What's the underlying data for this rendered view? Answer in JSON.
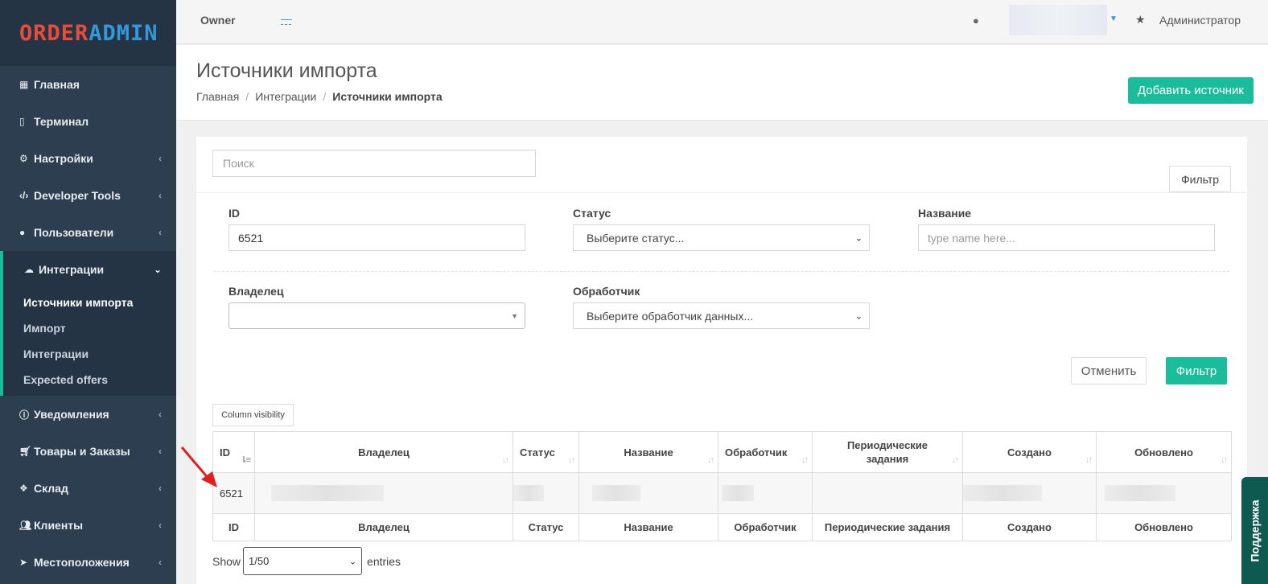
{
  "logo": {
    "part1": "ORDER",
    "part2": "ADMIN"
  },
  "sidebar": {
    "items": [
      {
        "label": "Главная",
        "icon": "grid-icon"
      },
      {
        "label": "Терминал",
        "icon": "terminal-icon"
      },
      {
        "label": "Настройки",
        "icon": "gear-icon",
        "has_children": true
      },
      {
        "label": "Developer Tools",
        "icon": "code-icon",
        "has_children": true
      },
      {
        "label": "Пользователи",
        "icon": "user-icon",
        "has_children": true
      },
      {
        "label": "Интеграции",
        "icon": "cloud-icon",
        "has_children": true,
        "expanded": true
      },
      {
        "label": "Уведомления",
        "icon": "info-icon",
        "has_children": true
      },
      {
        "label": "Товары и Заказы",
        "icon": "cart-icon",
        "has_children": true
      },
      {
        "label": "Склад",
        "icon": "cubes-icon",
        "has_children": true
      },
      {
        "label": "Клиенты",
        "icon": "users-icon",
        "has_children": true
      },
      {
        "label": "Местоположения",
        "icon": "location-arrow-icon",
        "has_children": true
      }
    ],
    "submenu": [
      {
        "label": "Источники импорта",
        "current": true
      },
      {
        "label": "Импорт"
      },
      {
        "label": "Интеграции"
      },
      {
        "label": "Expected offers"
      }
    ]
  },
  "topbar": {
    "owner_label": "Owner",
    "owner_value": "—",
    "admin_label": "Администратор"
  },
  "page": {
    "title": "Источники импорта",
    "breadcrumb": [
      "Главная",
      "Интеграции",
      "Источники импорта"
    ],
    "add_button": "Добавить источник"
  },
  "filters": {
    "search_placeholder": "Поиск",
    "filter_toggle": "Фильтр",
    "id_label": "ID",
    "id_value": "6521",
    "status_label": "Статус",
    "status_value": "Выберите статус...",
    "name_label": "Название",
    "name_placeholder": "type name here...",
    "owner_label": "Владелец",
    "handler_label": "Обработчик",
    "handler_value": "Выберите обработчик данных...",
    "cancel_button": "Отменить",
    "apply_button": "Фильтр"
  },
  "table": {
    "column_visibility": "Column visibility",
    "headers": [
      "ID",
      "Владелец",
      "Статус",
      "Название",
      "Обработчик",
      "Периодические задания",
      "Создано",
      "Обновлено"
    ],
    "rows": [
      {
        "id": "6521"
      }
    ],
    "footer": [
      "ID",
      "Владелец",
      "Статус",
      "Название",
      "Обработчик",
      "Периодические задания",
      "Создано",
      "Обновлено"
    ]
  },
  "pagination": {
    "show_label": "Show",
    "per_page": "1/50",
    "entries_label": "entries"
  },
  "support_tab": "Поддержка",
  "colors": {
    "sidebar_bg": "#2c3e50",
    "accent": "#1abc9c",
    "logo_red": "#e74c3c",
    "logo_blue": "#3498db",
    "annotation_arrow": "#e02020"
  }
}
